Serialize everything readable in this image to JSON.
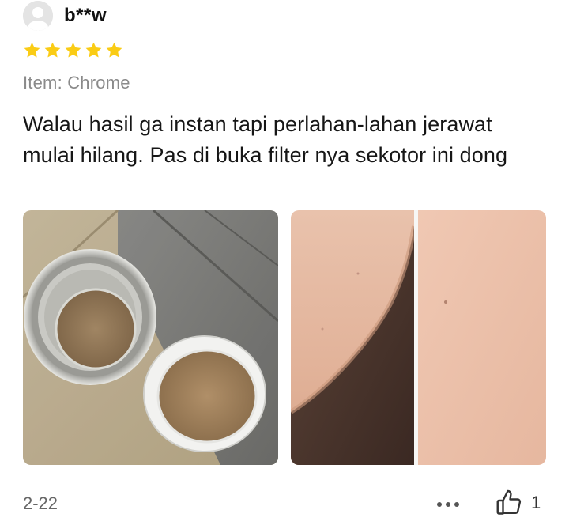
{
  "reviewer": {
    "name": "b**w",
    "avatar_icon": "default-user-avatar-icon"
  },
  "rating": {
    "value": 5,
    "max": 5,
    "star_color": "#FACC15"
  },
  "item": {
    "label": "Item: Chrome"
  },
  "review": {
    "text": "Walau hasil ga instan tapi perlahan-lahan jerawat mulai hilang. Pas di buka filter nya sekotor ini dong"
  },
  "photos": [
    {
      "icon": "photo-shower-filter-icon"
    },
    {
      "icon": "photo-skin-before-after-icon"
    }
  ],
  "footer": {
    "date": "2-22",
    "more_icon": "more-options-icon",
    "like_icon": "thumbs-up-icon",
    "like_count": "1"
  }
}
